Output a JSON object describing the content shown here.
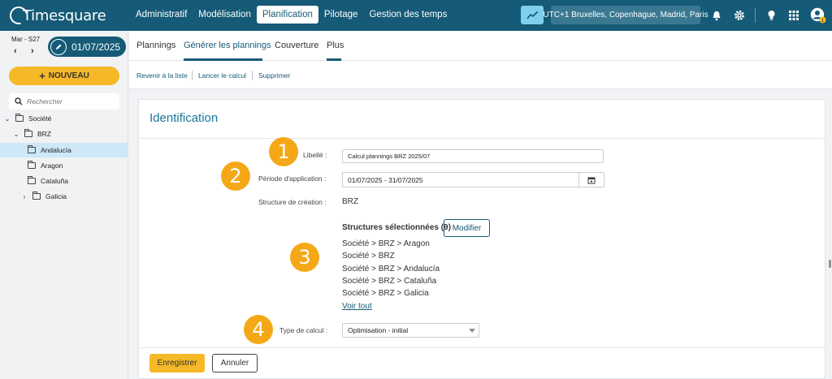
{
  "app": {
    "logo_text": "Timesquare",
    "nav": [
      "Administratif",
      "Modélisation",
      "Planification",
      "Pilotage",
      "Gestion des temps"
    ],
    "active_nav": "Planification",
    "timezone": "UTC+1 Bruxelles, Copenhague, Madrid, Paris",
    "icons": [
      "chart-icon",
      "bell-icon",
      "gear-icon",
      "lightbulb-icon",
      "apps-grid-icon",
      "user-account-icon"
    ],
    "notification_count": "1"
  },
  "sidebar": {
    "week_label": "Mar - S27",
    "current_date": "01/07/2025",
    "new_button": "NOUVEAU",
    "search_placeholder": "Rechercher",
    "tree": [
      {
        "label": "Société",
        "expanded": true,
        "level": 0
      },
      {
        "label": "BRZ",
        "expanded": true,
        "level": 1
      },
      {
        "label": "Andalucía",
        "level": 2,
        "selected": true
      },
      {
        "label": "Aragon",
        "level": 2
      },
      {
        "label": "Cataluña",
        "level": 2
      },
      {
        "label": "Galicia",
        "level": 2,
        "collapsed": true
      }
    ]
  },
  "tabs": [
    "Plannings",
    "Générer les plannings",
    "Couverture",
    "Plus"
  ],
  "active_tab": "Générer les plannings",
  "actions": [
    "Revenir à la liste",
    "Lancer le calcul",
    "Supprimer"
  ],
  "form": {
    "title": "Identification",
    "libelle_label": "Libellé :",
    "libelle_value": "Calcul plannings BRZ 2025/07",
    "periode_label": "Période d'application :",
    "periode_value": "01/07/2025 - 31/07/2025",
    "structure_label": "Structure de création :",
    "structure_value": "BRZ",
    "selected_title": "Structures sélectionnées (9)",
    "modify_label": "Modifier",
    "selected_structures": [
      "Société > BRZ > Aragon",
      "Société > BRZ",
      "Société > BRZ > Andalucía",
      "Société > BRZ > Cataluña",
      "Société > BRZ > Galicia"
    ],
    "see_all": "Voir tout",
    "calc_type_label": "Type de calcul :",
    "calc_type_value": "Optimisation - initial",
    "save_label": "Enregistrer",
    "cancel_label": "Annuler",
    "badges": [
      "1",
      "2",
      "3",
      "4"
    ]
  },
  "colors": {
    "header": "#155a76",
    "accent": "#f5b928",
    "badge": "#f5a817",
    "link": "#155a76",
    "selected_row": "#cde8f6"
  }
}
